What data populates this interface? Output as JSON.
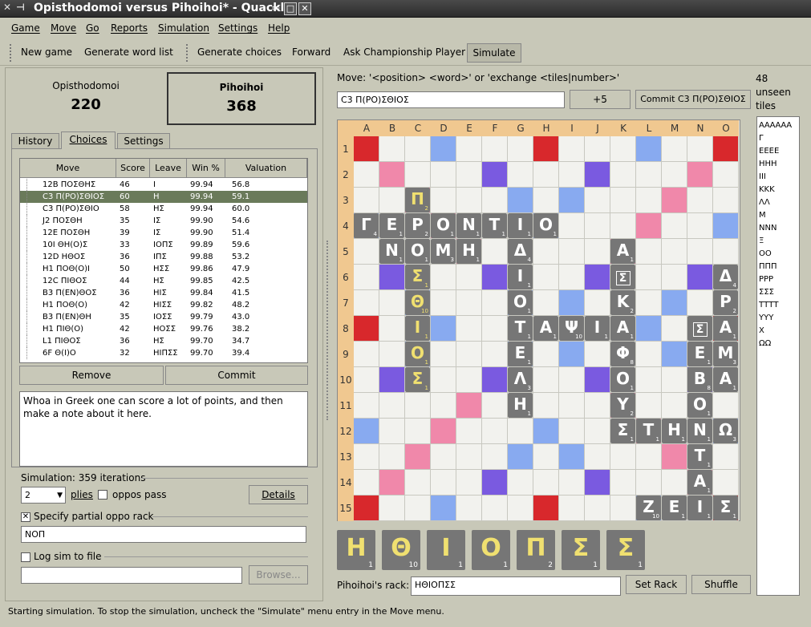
{
  "window": {
    "title": "Opisthodomoi versus Pihoihoi* - Quackle"
  },
  "menu": [
    "Game",
    "Move",
    "Go",
    "Reports",
    "Simulation",
    "Settings",
    "Help"
  ],
  "toolbar": {
    "new_game": "New game",
    "word_list": "Generate word list",
    "gen_choices": "Generate choices",
    "forward": "Forward",
    "ask": "Ask Championship Player",
    "simulate": "Simulate"
  },
  "players": [
    {
      "name": "Opisthodomoi",
      "score": "220"
    },
    {
      "name": "Pihoihoi",
      "score": "368"
    }
  ],
  "tabs": [
    "History",
    "Choices",
    "Settings"
  ],
  "choices": {
    "headers": [
      "Move",
      "Score",
      "Leave",
      "Win %",
      "Valuation"
    ],
    "rows": [
      [
        "12B ΠΟΣΘΗΣ",
        "46",
        "Ι",
        "99.94",
        "56.8"
      ],
      [
        "C3 Π(ΡΟ)ΣΘΙΟΣ",
        "60",
        "Η",
        "99.94",
        "59.1"
      ],
      [
        "C3 Π(ΡΟ)ΣΘΙΟ",
        "58",
        "ΗΣ",
        "99.94",
        "60.0"
      ],
      [
        "J2 ΠΟΣΘΗ",
        "35",
        "ΙΣ",
        "99.90",
        "54.6"
      ],
      [
        "12E ΠΟΣΘΗ",
        "39",
        "ΙΣ",
        "99.90",
        "51.4"
      ],
      [
        "10I ΘΗ(Ο)Σ",
        "33",
        "ΙΟΠΣ",
        "99.89",
        "59.6"
      ],
      [
        "12D ΗΘΟΣ",
        "36",
        "ΙΠΣ",
        "99.88",
        "53.2"
      ],
      [
        "H1 ΠΟΘ(Ο)Ι",
        "50",
        "ΗΣΣ",
        "99.86",
        "47.9"
      ],
      [
        "12C ΠΙΘΟΣ",
        "44",
        "ΗΣ",
        "99.85",
        "42.5"
      ],
      [
        "B3 Π(ΕΝ)ΘΟΣ",
        "36",
        "ΗΙΣ",
        "99.84",
        "41.5"
      ],
      [
        "H1 ΠΟΘ(Ο)",
        "42",
        "ΗΙΣΣ",
        "99.82",
        "48.2"
      ],
      [
        "B3 Π(ΕΝ)ΘΗ",
        "35",
        "ΙΟΣΣ",
        "99.79",
        "43.0"
      ],
      [
        "H1 ΠΙΘ(Ο)",
        "42",
        "ΗΟΣΣ",
        "99.76",
        "38.2"
      ],
      [
        "L1 ΠΙΘΟΣ",
        "36",
        "ΗΣ",
        "99.70",
        "34.7"
      ],
      [
        "6F Θ(Ι)Ο",
        "32",
        "ΗΙΠΣΣ",
        "99.70",
        "39.4"
      ]
    ],
    "selected": 1
  },
  "buttons": {
    "remove": "Remove",
    "commit": "Commit",
    "details": "Details",
    "browse": "Browse...",
    "plus5": "+5",
    "commit_move": "Commit C3 Π(ΡΟ)ΣΘΙΟΣ",
    "set_rack": "Set Rack",
    "shuffle": "Shuffle"
  },
  "note": "Whoa in Greek one can score a lot of points, and then make a note about it here.",
  "sim": {
    "iterations": "Simulation: 359 iterations",
    "plies_value": "2",
    "plies_label": "plies",
    "oppos_pass": "oppos pass",
    "partial_label": "Specify partial oppo rack",
    "partial_value": "ΝΟΠ",
    "log_label": "Log sim to file",
    "log_value": ""
  },
  "move_prompt": "Move: '<position> <word>' or 'exchange <tiles|number>'",
  "move_input": "C3 Π(ΡΟ)ΣΘΙΟΣ",
  "unseen": {
    "title": "48 unseen tiles",
    "list": [
      "ΑΑΑΑΑΑ",
      "Γ",
      "ΕΕΕΕ",
      "ΗΗΗ",
      "ΙΙΙ",
      "ΚΚΚ",
      "ΛΛ",
      "Μ",
      "ΝΝΝ",
      "Ξ",
      "ΟΟ",
      "ΠΠΠ",
      "ΡΡΡ",
      "ΣΣΣ",
      "ΤΤΤΤ",
      "ΥΥΥ",
      "Χ",
      "ΩΩ"
    ]
  },
  "board": {
    "cols": [
      "A",
      "B",
      "C",
      "D",
      "E",
      "F",
      "G",
      "H",
      "I",
      "J",
      "K",
      "L",
      "M",
      "N",
      "O"
    ],
    "rows": [
      "1",
      "2",
      "3",
      "4",
      "5",
      "6",
      "7",
      "8",
      "9",
      "10",
      "11",
      "12",
      "13",
      "14",
      "15"
    ],
    "tiles": [
      {
        "r": 3,
        "c": 2,
        "l": "Π",
        "s": "2",
        "n": true
      },
      {
        "r": 4,
        "c": 0,
        "l": "Γ",
        "s": "4"
      },
      {
        "r": 4,
        "c": 1,
        "l": "Ε",
        "s": "1"
      },
      {
        "r": 4,
        "c": 2,
        "l": "Ρ",
        "s": "2"
      },
      {
        "r": 4,
        "c": 3,
        "l": "Ο",
        "s": "1"
      },
      {
        "r": 4,
        "c": 4,
        "l": "Ν",
        "s": "1"
      },
      {
        "r": 4,
        "c": 5,
        "l": "Τ",
        "s": "1"
      },
      {
        "r": 4,
        "c": 6,
        "l": "Ι",
        "s": "1"
      },
      {
        "r": 4,
        "c": 7,
        "l": "Ο",
        "s": "1"
      },
      {
        "r": 5,
        "c": 1,
        "l": "Ν",
        "s": "1"
      },
      {
        "r": 5,
        "c": 2,
        "l": "Ο",
        "s": "1"
      },
      {
        "r": 5,
        "c": 3,
        "l": "Μ",
        "s": "3"
      },
      {
        "r": 5,
        "c": 4,
        "l": "Η",
        "s": "1"
      },
      {
        "r": 5,
        "c": 6,
        "l": "Δ",
        "s": "4"
      },
      {
        "r": 5,
        "c": 10,
        "l": "Α",
        "s": "1"
      },
      {
        "r": 6,
        "c": 2,
        "l": "Σ",
        "s": "1",
        "n": true
      },
      {
        "r": 6,
        "c": 6,
        "l": "Ι",
        "s": "1"
      },
      {
        "r": 6,
        "c": 10,
        "l": "Σ",
        "s": "",
        "b": true
      },
      {
        "r": 6,
        "c": 14,
        "l": "Δ",
        "s": "4"
      },
      {
        "r": 7,
        "c": 2,
        "l": "Θ",
        "s": "10",
        "n": true
      },
      {
        "r": 7,
        "c": 6,
        "l": "Ο",
        "s": "1"
      },
      {
        "r": 7,
        "c": 10,
        "l": "Κ",
        "s": "2"
      },
      {
        "r": 7,
        "c": 14,
        "l": "Ρ",
        "s": "2"
      },
      {
        "r": 8,
        "c": 2,
        "l": "Ι",
        "s": "1",
        "n": true
      },
      {
        "r": 8,
        "c": 6,
        "l": "Τ",
        "s": "1"
      },
      {
        "r": 8,
        "c": 7,
        "l": "Α",
        "s": "1"
      },
      {
        "r": 8,
        "c": 8,
        "l": "Ψ",
        "s": "10"
      },
      {
        "r": 8,
        "c": 9,
        "l": "Ι",
        "s": "1"
      },
      {
        "r": 8,
        "c": 10,
        "l": "Α",
        "s": "1"
      },
      {
        "r": 8,
        "c": 13,
        "l": "Σ",
        "s": "",
        "b": true
      },
      {
        "r": 8,
        "c": 14,
        "l": "Α",
        "s": "1"
      },
      {
        "r": 9,
        "c": 2,
        "l": "Ο",
        "s": "1",
        "n": true
      },
      {
        "r": 9,
        "c": 6,
        "l": "Ε",
        "s": "1"
      },
      {
        "r": 9,
        "c": 10,
        "l": "Φ",
        "s": "8"
      },
      {
        "r": 9,
        "c": 13,
        "l": "Ε",
        "s": "1"
      },
      {
        "r": 9,
        "c": 14,
        "l": "Μ",
        "s": "3"
      },
      {
        "r": 10,
        "c": 2,
        "l": "Σ",
        "s": "1",
        "n": true
      },
      {
        "r": 10,
        "c": 6,
        "l": "Λ",
        "s": "3"
      },
      {
        "r": 10,
        "c": 10,
        "l": "Ο",
        "s": "1"
      },
      {
        "r": 10,
        "c": 13,
        "l": "Β",
        "s": "8"
      },
      {
        "r": 10,
        "c": 14,
        "l": "Α",
        "s": "1"
      },
      {
        "r": 11,
        "c": 6,
        "l": "Η",
        "s": "1"
      },
      {
        "r": 11,
        "c": 10,
        "l": "Υ",
        "s": "2"
      },
      {
        "r": 11,
        "c": 13,
        "l": "Ο",
        "s": "1"
      },
      {
        "r": 12,
        "c": 10,
        "l": "Σ",
        "s": "1"
      },
      {
        "r": 12,
        "c": 11,
        "l": "Τ",
        "s": "1"
      },
      {
        "r": 12,
        "c": 12,
        "l": "Η",
        "s": "1"
      },
      {
        "r": 12,
        "c": 13,
        "l": "Ν",
        "s": "1"
      },
      {
        "r": 12,
        "c": 14,
        "l": "Ω",
        "s": "3"
      },
      {
        "r": 13,
        "c": 13,
        "l": "Τ",
        "s": "1"
      },
      {
        "r": 14,
        "c": 13,
        "l": "Α",
        "s": "1"
      },
      {
        "r": 15,
        "c": 11,
        "l": "Ζ",
        "s": "10"
      },
      {
        "r": 15,
        "c": 12,
        "l": "Ε",
        "s": "1"
      },
      {
        "r": 15,
        "c": 13,
        "l": "Ι",
        "s": "1"
      },
      {
        "r": 15,
        "c": 14,
        "l": "Σ",
        "s": "1"
      }
    ]
  },
  "rack": {
    "label": "Pihoihoi's rack:",
    "value": "ΗΘΙΟΠΣΣ",
    "tiles": [
      {
        "l": "Η",
        "s": "1"
      },
      {
        "l": "Θ",
        "s": "10"
      },
      {
        "l": "Ι",
        "s": "1"
      },
      {
        "l": "Ο",
        "s": "1"
      },
      {
        "l": "Π",
        "s": "2"
      },
      {
        "l": "Σ",
        "s": "1"
      },
      {
        "l": "Σ",
        "s": "1"
      }
    ]
  },
  "status": "Starting simulation. To stop the simulation, uncheck the \"Simulate\" menu entry in the Move menu.",
  "colors": {
    "tw": "#d8282c",
    "dw": "#f088aa",
    "tl": "#7a5ae0",
    "dl": "#88aaf0",
    "tile": "#767676",
    "new_letter": "#f0e070"
  }
}
